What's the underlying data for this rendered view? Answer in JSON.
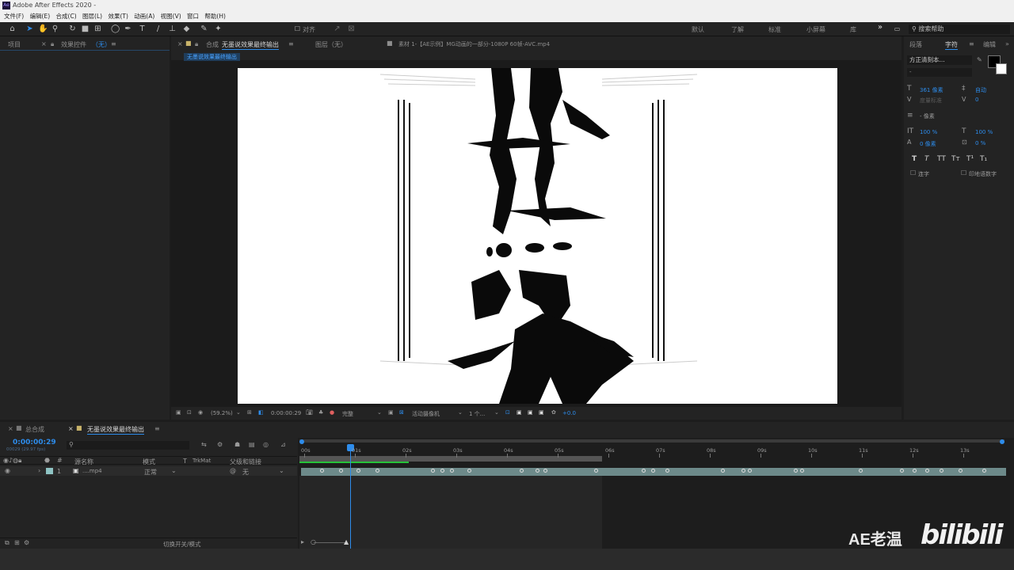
{
  "titlebar": {
    "title": "Adobe After Effects 2020 -",
    "logo": "Ae"
  },
  "menubar": [
    "文件(F)",
    "编辑(E)",
    "合成(C)",
    "图层(L)",
    "效果(T)",
    "动画(A)",
    "视图(V)",
    "窗口",
    "帮助(H)"
  ],
  "toolbar": {
    "align_label": "对齐",
    "workspaces": [
      "默认",
      "了解",
      "标准",
      "小屏幕",
      "库"
    ],
    "overflow": "»",
    "search_placeholder": "搜索帮助"
  },
  "project_panel": {
    "tab_project": "项目",
    "tab_effects": "效果控件",
    "tab_effects_target": "（无）",
    "menu": "≡"
  },
  "comp_panel": {
    "tab_comp_prefix": "合成",
    "tab_comp_name": "无墨说效果最终输出",
    "tab_layer": "图层（无）",
    "tab_footage": "素材 1-【AE示例】MG动画的一部分-1080P 60帧-AVC.mp4",
    "breadcrumb": "无墨说效果最终输出"
  },
  "viewer_bar": {
    "zoom": "(59.2%)",
    "timecode": "0:00:00:29",
    "resolution": "完整",
    "camera": "活动摄像机",
    "views": "1 个...",
    "exposure": "+0.0"
  },
  "right_panel": {
    "tab_align": "段落",
    "tab_character": "字符",
    "tab_paragraph": "编辑",
    "font_name": "方正清刻本...",
    "font_style": "-",
    "font_size": "361 像素",
    "leading": "自动",
    "kerning": "度量标准",
    "tracking": "0",
    "stroke_width": "- 像素",
    "vscale": "100 %",
    "hscale": "100 %",
    "baseline": "0 像素",
    "tsume": "0 %",
    "styles": [
      "T",
      "T",
      "TT",
      "Tт",
      "T¹",
      "T₁"
    ],
    "ligature_label": "连字",
    "hindi_label": "印地语数字"
  },
  "timeline": {
    "tab_main": "总合成",
    "tab_active": "无墨说效果最终输出",
    "current_time": "0:00:00:29",
    "frame_info": "00029 (29.97 fps)",
    "search_placeholder": "",
    "col_source": "源名称",
    "col_mode": "模式",
    "col_t": "T",
    "col_trkmat": "TrkMat",
    "col_parent": "父级和链接",
    "layer_index": "1",
    "layer_name": "....mp4",
    "layer_mode": "正常",
    "layer_parent": "无",
    "ruler": [
      "00s",
      "01s",
      "02s",
      "03s",
      "04s",
      "05s",
      "06s",
      "07s",
      "08s",
      "09s",
      "10s",
      "11s",
      "12s",
      "13s"
    ],
    "toggle_label": "切换开关/模式"
  },
  "watermark": {
    "brand": "AE老温",
    "site": "bilibili"
  },
  "colors": {
    "accent": "#2d8ceb",
    "panel": "#232323",
    "bg": "#1d1d1d"
  }
}
